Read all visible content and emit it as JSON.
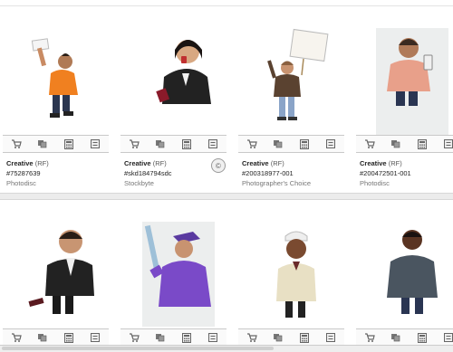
{
  "results": [
    {
      "license": "Creative",
      "license_type": "(RF)",
      "image_id": "#75287639",
      "provider": "Photodisc"
    },
    {
      "license": "Creative",
      "license_type": "(RF)",
      "image_id": "#skd184794sdc",
      "provider": "Stockbyte",
      "badge": "©"
    },
    {
      "license": "Creative",
      "license_type": "(RF)",
      "image_id": "#200318977-001",
      "provider": "Photographer's Choice"
    },
    {
      "license": "Creative",
      "license_type": "(RF)",
      "image_id": "#200472501-001",
      "provider": "Photodisc"
    }
  ],
  "toolbar_icons": [
    "add-to-cart-icon",
    "lightbox-icon",
    "calculate-price-icon",
    "image-details-icon"
  ],
  "colors": {
    "icon": "#666666",
    "separator": "#c9c9c9",
    "row_gap": "#ececec"
  }
}
